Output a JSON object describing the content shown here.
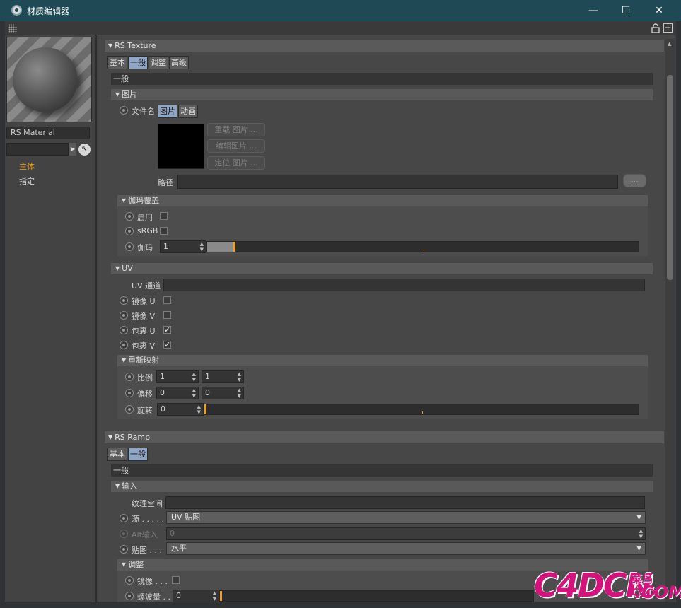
{
  "window": {
    "title": "材质编辑器",
    "min": "—",
    "max": "☐",
    "close": "✕"
  },
  "left": {
    "material_name": "RS Material",
    "nav": [
      {
        "label": "主体",
        "color": "#f0a01a"
      },
      {
        "label": "指定",
        "color": "#d2d2d2"
      }
    ]
  },
  "texture": {
    "header": "RS Texture",
    "tabs": [
      "基本",
      "一般",
      "调整",
      "高级"
    ],
    "section_label": "一般",
    "image_group": {
      "header": "图片",
      "filename_label": "文件名",
      "subtabs": [
        "图片",
        "动画"
      ],
      "reload_button": "重载 图片 ...",
      "edit_button": "编辑图片 ...",
      "locate_button": "定位 图片 ...",
      "path_label": "路径",
      "path_value": "",
      "browse_button": "..."
    },
    "gamma_group": {
      "header": "伽玛覆盖",
      "enable_label": "启用",
      "srgb_label": "sRGB",
      "gamma_label": "伽玛",
      "gamma_value": "1"
    },
    "uv_group": {
      "header": "UV",
      "uv_channel_label": "UV 通道",
      "mirror_u": "镜像 U",
      "mirror_v": "镜像 V",
      "wrap_u": "包裹 U",
      "wrap_v": "包裹 V",
      "check": "✓"
    },
    "remap_group": {
      "header": "重新映射",
      "scale_label": "比例",
      "scale_x": "1",
      "scale_y": "1",
      "offset_label": "偏移",
      "offset_x": "0",
      "offset_y": "0",
      "rotate_label": "旋转",
      "rotate_value": "0"
    }
  },
  "ramp": {
    "header": "RS Ramp",
    "tabs": [
      "基本",
      "一般"
    ],
    "section_label": "一般",
    "input_group": {
      "header": "输入",
      "texture_space_label": "纹理空间",
      "source_label": "源 . . . . .",
      "source_value": "UV 贴图",
      "alt_input_label": "Alt输入",
      "alt_input_value": "0",
      "map_label": "贴图 . . .",
      "map_value": "水平"
    },
    "adjust_group": {
      "header": "调整",
      "mirror_label": "镜像 . . .",
      "ripple_label": "螺波量 . .",
      "ripple_value": "0"
    }
  },
  "watermark": {
    "main": "C4DCN",
    "cn": "菜鸟C4D",
    "sub": ".COM"
  }
}
